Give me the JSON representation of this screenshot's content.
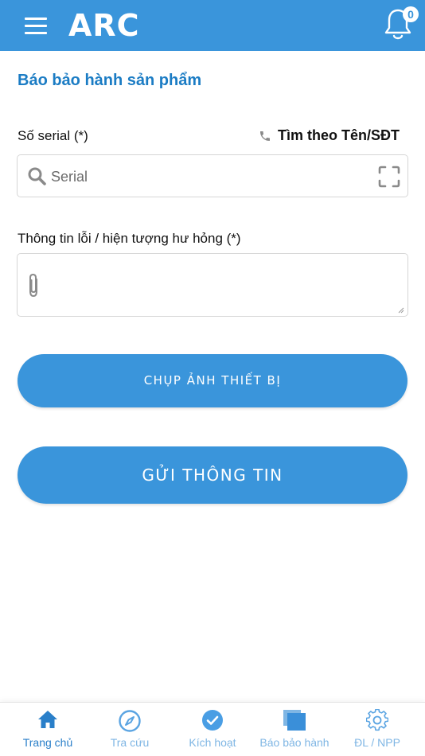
{
  "header": {
    "logo_text": "ARC",
    "notification_count": "0"
  },
  "page": {
    "title": "Báo bảo hành sản phẩm",
    "serial_label": "Số serial (*)",
    "search_by_name_phone": "Tìm theo Tên/SĐT",
    "serial_placeholder": "Serial",
    "serial_value": "",
    "error_label": "Thông tin lỗi / hiện tượng hư hỏng (*)",
    "error_value": ""
  },
  "buttons": {
    "take_photo": "CHỤP ẢNH THIẾT BỊ",
    "submit": "GỬI THÔNG TIN"
  },
  "bottom_nav": {
    "items": [
      {
        "label": "Trang chủ",
        "icon": "home-icon",
        "active": true
      },
      {
        "label": "Tra cứu",
        "icon": "compass-icon",
        "active": false
      },
      {
        "label": "Kích hoạt",
        "icon": "check-circle-icon",
        "active": false
      },
      {
        "label": "Báo bảo hành",
        "icon": "stacked-squares-icon",
        "active": false
      },
      {
        "label": "ĐL / NPP",
        "icon": "gear-icon",
        "active": false
      }
    ]
  },
  "colors": {
    "primary": "#3a95db",
    "title": "#1b7cc4",
    "nav_inactive": "#7fb6e4",
    "nav_active": "#2a7fc9"
  }
}
